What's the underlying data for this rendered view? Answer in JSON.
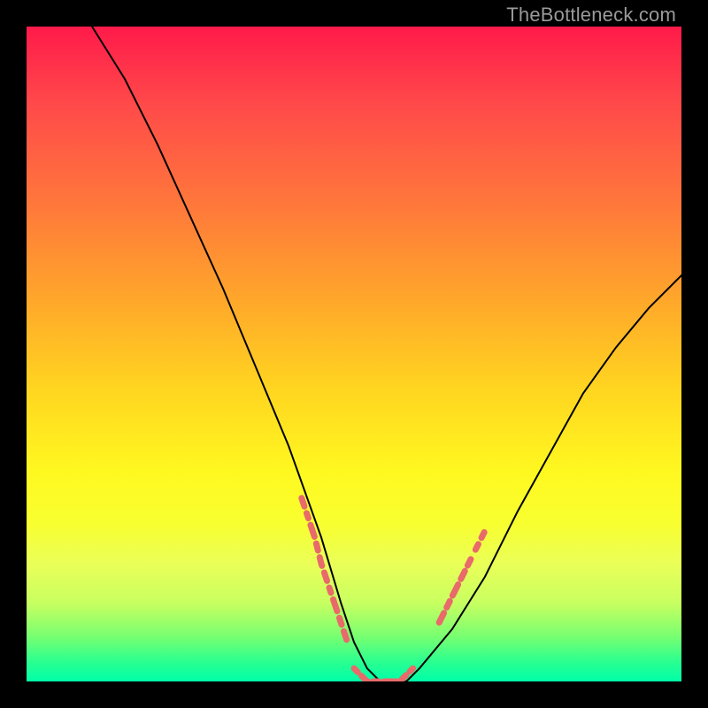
{
  "watermark": {
    "text": "TheBottleneck.com"
  },
  "colors": {
    "background": "#000000",
    "gradient_top": "#ff1a4a",
    "gradient_bottom": "#00ffa8",
    "curve": "#000000",
    "accent_dash": "#e86a6a"
  },
  "chart_data": {
    "type": "line",
    "title": "",
    "xlabel": "",
    "ylabel": "",
    "xlim": [
      0,
      100
    ],
    "ylim": [
      0,
      100
    ],
    "legend": false,
    "grid": false,
    "series": [
      {
        "name": "bottleneck-curve",
        "x": [
          10,
          15,
          20,
          25,
          30,
          35,
          40,
          45,
          48,
          50,
          52,
          54,
          56,
          58,
          60,
          65,
          70,
          75,
          80,
          85,
          90,
          95,
          100
        ],
        "y": [
          100,
          92,
          82,
          71,
          60,
          48,
          36,
          22,
          12,
          6,
          2,
          0,
          0,
          0,
          2,
          8,
          16,
          26,
          35,
          44,
          51,
          57,
          62
        ]
      }
    ],
    "annotations": [
      {
        "name": "highlight-left-descent",
        "style": "dashed",
        "color": "#e86a6a",
        "x": [
          42,
          44,
          45,
          46,
          47,
          48,
          49
        ],
        "y": [
          28,
          22,
          18,
          15,
          12,
          9,
          6
        ]
      },
      {
        "name": "highlight-valley-floor",
        "style": "dashed",
        "color": "#e86a6a",
        "x": [
          50,
          51,
          52,
          53,
          54,
          55,
          56,
          57,
          58,
          59
        ],
        "y": [
          2,
          1,
          0,
          0,
          0,
          0,
          0,
          0,
          1,
          2
        ]
      },
      {
        "name": "highlight-right-ascent",
        "style": "dashed",
        "color": "#e86a6a",
        "x": [
          63,
          64,
          65,
          66,
          67,
          68,
          69,
          70
        ],
        "y": [
          9,
          11,
          13,
          15,
          17,
          19,
          21,
          23
        ]
      }
    ]
  }
}
